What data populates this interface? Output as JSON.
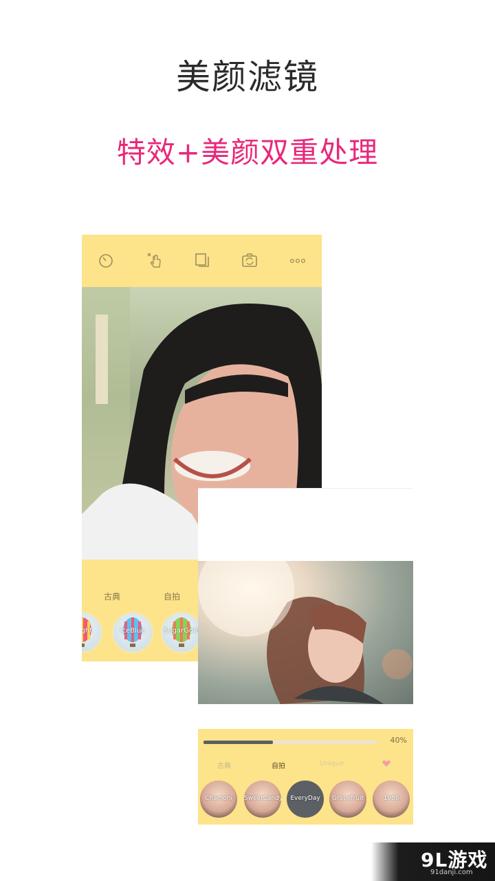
{
  "headline": "美颜滤镜",
  "subheadline": "特效+美颜双重处理",
  "colors": {
    "accent_pink": "#e8287a",
    "panel_yellow": "#fde38a",
    "slider_fill": "#5a5f63"
  },
  "screenA": {
    "toolbar_icons": [
      "timer-icon",
      "touch-shutter-icon",
      "collage-icon",
      "switch-camera-icon",
      "more-icon"
    ],
    "filter_tabs": [
      "古典",
      "自拍"
    ],
    "filters": [
      "Bright",
      "IceBlue",
      "SugarGold"
    ]
  },
  "screenB": {
    "intensity": {
      "label": "40%",
      "value": 0.4
    },
    "filter_tabs": [
      "古典",
      "自拍",
      "Unique"
    ],
    "favorite_icon": "heart-icon",
    "filters": [
      "Chamoni",
      "SweetCandy",
      "EveryDay",
      "Grapefruit",
      "1986"
    ]
  },
  "watermark": {
    "logo": "9L游戏",
    "url": "91danji.com"
  }
}
